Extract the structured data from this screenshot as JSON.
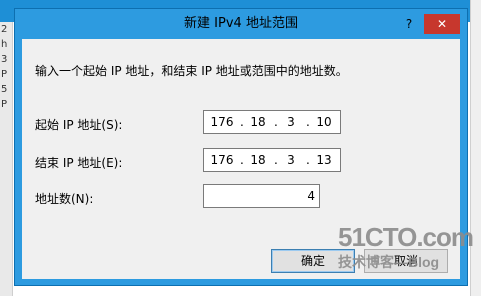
{
  "background": {
    "fragments": [
      "2",
      "h",
      "3",
      "P",
      "5",
      "P"
    ]
  },
  "dialog": {
    "title": "新建 IPv4 地址范围",
    "help_label": "?",
    "close_label": "✕",
    "description": "输入一个起始 IP 地址，和结束 IP 地址或范围中的地址数。",
    "start_ip": {
      "label": "起始 IP 地址(S):",
      "octets": [
        "176",
        "18",
        "3",
        "10"
      ]
    },
    "end_ip": {
      "label": "结束 IP 地址(E):",
      "octets": [
        "176",
        "18",
        "3",
        "13"
      ]
    },
    "address_count": {
      "label": "地址数(N):",
      "value": "4"
    },
    "ok_label": "确定",
    "cancel_label": "取消"
  },
  "watermark": {
    "main": "51CTO.com",
    "sub": "技术博客—Blog"
  },
  "colors": {
    "title_bar": "#2d9be0",
    "close_button": "#c7372d",
    "client": "#f0f0f0"
  }
}
